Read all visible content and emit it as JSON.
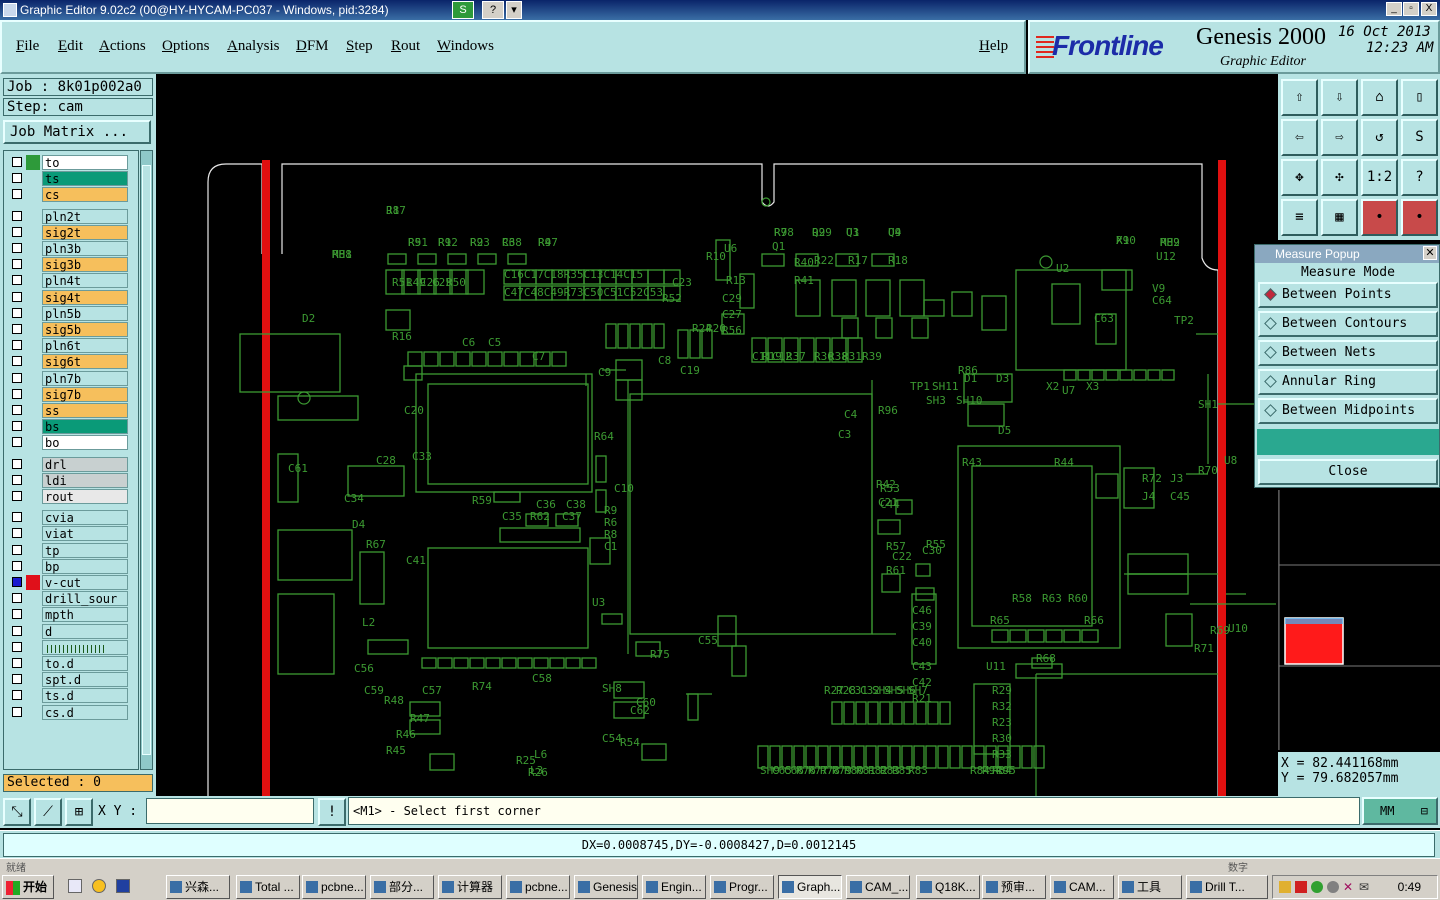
{
  "window": {
    "title": "Graphic Editor 9.02c2 (00@HY-HYCAM-PC037 - Windows, pid:3284)",
    "mini_buttons": [
      "S",
      "?",
      "▾"
    ],
    "controls": [
      "_",
      "▫",
      "X"
    ]
  },
  "menu": [
    "File",
    "Edit",
    "Actions",
    "Options",
    "Analysis",
    "DFM",
    "Step",
    "Rout",
    "Windows"
  ],
  "help": "Help",
  "brand": {
    "logo": "Frontline",
    "product": "Genesis 2000",
    "subtitle": "Graphic Editor",
    "date": "16 Oct 2013",
    "time": "12:23 AM"
  },
  "job": {
    "job_line": "Job : 8k01p002a0",
    "step_line": "Step: cam",
    "matrix_button": "Job Matrix ..."
  },
  "layers": [
    {
      "name": "to",
      "color": "#ffffff",
      "swatch": "#2e9a3a"
    },
    {
      "name": "ts",
      "color": "#0a9a78",
      "swatch": "#b7e3e3"
    },
    {
      "name": "cs",
      "color": "#f6bf5c",
      "swatch": "#b7e3e3"
    },
    {
      "name": "pln2t",
      "color": "#b7e3e3",
      "swatch": "#b7e3e3"
    },
    {
      "name": "sig2t",
      "color": "#f6bf5c",
      "swatch": "#b7e3e3"
    },
    {
      "name": "pln3b",
      "color": "#b7e3e3",
      "swatch": "#b7e3e3"
    },
    {
      "name": "sig3b",
      "color": "#f6bf5c",
      "swatch": "#b7e3e3"
    },
    {
      "name": "pln4t",
      "color": "#b7e3e3",
      "swatch": "#b7e3e3"
    },
    {
      "name": "sig4t",
      "color": "#f6bf5c",
      "swatch": "#b7e3e3"
    },
    {
      "name": "pln5b",
      "color": "#b7e3e3",
      "swatch": "#b7e3e3"
    },
    {
      "name": "sig5b",
      "color": "#f6bf5c",
      "swatch": "#b7e3e3"
    },
    {
      "name": "pln6t",
      "color": "#b7e3e3",
      "swatch": "#b7e3e3"
    },
    {
      "name": "sig6t",
      "color": "#f6bf5c",
      "swatch": "#b7e3e3"
    },
    {
      "name": "pln7b",
      "color": "#b7e3e3",
      "swatch": "#b7e3e3"
    },
    {
      "name": "sig7b",
      "color": "#f6bf5c",
      "swatch": "#b7e3e3"
    },
    {
      "name": "ss",
      "color": "#f6bf5c",
      "swatch": "#b7e3e3"
    },
    {
      "name": "bs",
      "color": "#0a9a78",
      "swatch": "#b7e3e3"
    },
    {
      "name": "bo",
      "color": "#ffffff",
      "swatch": "#b7e3e3"
    },
    {
      "name": "drl",
      "color": "#c8d0d0",
      "swatch": "#b7e3e3"
    },
    {
      "name": "ldi",
      "color": "#c8d0d0",
      "swatch": "#b7e3e3"
    },
    {
      "name": "rout",
      "color": "#e8e8e8",
      "swatch": "#b7e3e3"
    },
    {
      "name": "cvia",
      "color": "#b7e3e3",
      "swatch": "#b7e3e3"
    },
    {
      "name": "viat",
      "color": "#b7e3e3",
      "swatch": "#b7e3e3"
    },
    {
      "name": "tp",
      "color": "#b7e3e3",
      "swatch": "#b7e3e3"
    },
    {
      "name": "bp",
      "color": "#b7e3e3",
      "swatch": "#b7e3e3"
    },
    {
      "name": "v-cut",
      "color": "#b7e3e3",
      "swatch": "#e0101a"
    },
    {
      "name": "drill_sour",
      "color": "#b7e3e3",
      "swatch": "#b7e3e3"
    },
    {
      "name": "mpth",
      "color": "#b7e3e3",
      "swatch": "#b7e3e3"
    },
    {
      "name": "d",
      "color": "#b7e3e3",
      "swatch": "#b7e3e3"
    },
    {
      "name": "",
      "color": "#b7e3e3",
      "swatch": "#b7e3e3"
    },
    {
      "name": "to.d",
      "color": "#b7e3e3",
      "swatch": "#b7e3e3"
    },
    {
      "name": "spt.d",
      "color": "#b7e3e3",
      "swatch": "#b7e3e3"
    },
    {
      "name": "ts.d",
      "color": "#b7e3e3",
      "swatch": "#b7e3e3"
    },
    {
      "name": "cs.d",
      "color": "#b7e3e3",
      "swatch": "#b7e3e3"
    }
  ],
  "selected": "Selected : 0",
  "measure": {
    "title": "Measure Popup",
    "mode_label": "Measure Mode",
    "options": [
      "Between Points",
      "Between Contours",
      "Between Nets",
      "Annular Ring",
      "Between Midpoints"
    ],
    "active_index": 0,
    "close": "Close"
  },
  "coords": {
    "x": "X = 82.441168mm",
    "y": "Y = 79.682057mm"
  },
  "command": {
    "xy_label": "X Y :",
    "xy_value": "",
    "prompt": "<M1> - Select first corner",
    "units": "MM",
    "status": "DX=0.0008745,DY=-0.0008427,D=0.0012145"
  },
  "tools": [
    "⇧",
    "⇩",
    "⌂",
    "▯",
    "⇦",
    "⇨",
    "↺",
    "S",
    "✥",
    "✣",
    "1:2",
    "?",
    "≡",
    "▦",
    "•",
    "•"
  ],
  "board_labels": [
    "J1",
    "MH1",
    "MH2",
    "X1",
    "R5",
    "R1",
    "R2",
    "R3",
    "R4",
    "R7",
    "Q2",
    "Q3",
    "Q4",
    "Q1",
    "R22",
    "R17",
    "R18",
    "R13",
    "U6",
    "R10",
    "C16C17C18R35C13C14C15",
    "C47C48C49R73C50C51C52C53",
    "C23",
    "R52",
    "R51",
    "R49",
    "C26",
    "C25",
    "R50",
    "D2",
    "R16",
    "C6",
    "C5",
    "C7",
    "C8",
    "C9",
    "C19",
    "C20",
    "C28",
    "C33",
    "C34",
    "R59",
    "C35",
    "R62",
    "C37",
    "C36",
    "C38",
    "C41",
    "R67",
    "D4",
    "L2",
    "C56",
    "C59",
    "C57",
    "R74",
    "C58",
    "SH8",
    "C60",
    "C62",
    "R75",
    "C54",
    "C55",
    "R64",
    "U3",
    "U2",
    "U7",
    "U8",
    "U10",
    "U11",
    "U12",
    "TP1",
    "TP2",
    "SH1",
    "SH3",
    "SH10",
    "SH11",
    "X2",
    "X3",
    "D1",
    "D3",
    "D5",
    "R43",
    "R44",
    "R42",
    "C21",
    "C22",
    "R55",
    "R57",
    "C30",
    "R61",
    "R58",
    "R63",
    "R60",
    "R65",
    "R66",
    "R70",
    "R69",
    "R71",
    "R68",
    "R72",
    "J3",
    "J4",
    "C45",
    "C46",
    "C39",
    "C40",
    "C43",
    "C42",
    "R21",
    "R29",
    "R32",
    "R23",
    "R30",
    "R33",
    "R34",
    "R45",
    "R46",
    "R47",
    "R48",
    "R54",
    "L3",
    "L6",
    "C61",
    "C63",
    "C64",
    "V9",
    "R53",
    "C44",
    "C3",
    "C4",
    "R56",
    "C27",
    "C29",
    "R24",
    "R20",
    "R19",
    "C11",
    "C12",
    "R37",
    "R36",
    "R38",
    "R31",
    "R39",
    "R40",
    "R41",
    "C10",
    "R9",
    "R6",
    "R8",
    "C1",
    "R25",
    "R26",
    "R27",
    "R28",
    "C31",
    "C32",
    "SH4",
    "SH5",
    "SH6",
    "SH7",
    "SH9",
    "C65",
    "C66",
    "R76",
    "R77",
    "R78",
    "R79",
    "R80",
    "R81",
    "R82",
    "R83",
    "R85",
    "R83",
    "R84",
    "R94",
    "R95",
    "R96",
    "R86",
    "R87",
    "R88",
    "R89",
    "R90",
    "R91",
    "R92",
    "R93",
    "C68",
    "R97",
    "R98",
    "R99",
    "U1",
    "U9"
  ],
  "taskbar": {
    "start": "开始",
    "corner_left": "就绪",
    "corner_right": "数字",
    "tasks": [
      "兴森...",
      "Total ...",
      "pcbne...",
      "部分...",
      "计算器",
      "pcbne...",
      "Genesis",
      "Engin...",
      "Progr...",
      "Graph...",
      "CAM_...",
      "Q18K...",
      "预审...",
      "CAM...",
      "工具",
      "Drill T..."
    ],
    "active_task": 9,
    "clock": "0:49"
  },
  "colors": {
    "panel": "#b7e3e3",
    "layer_orange": "#f6bf5c",
    "layer_green": "#0a9a78",
    "board_trace": "#3c9a32",
    "vcut": "#e01010",
    "canvas": "#000000"
  }
}
